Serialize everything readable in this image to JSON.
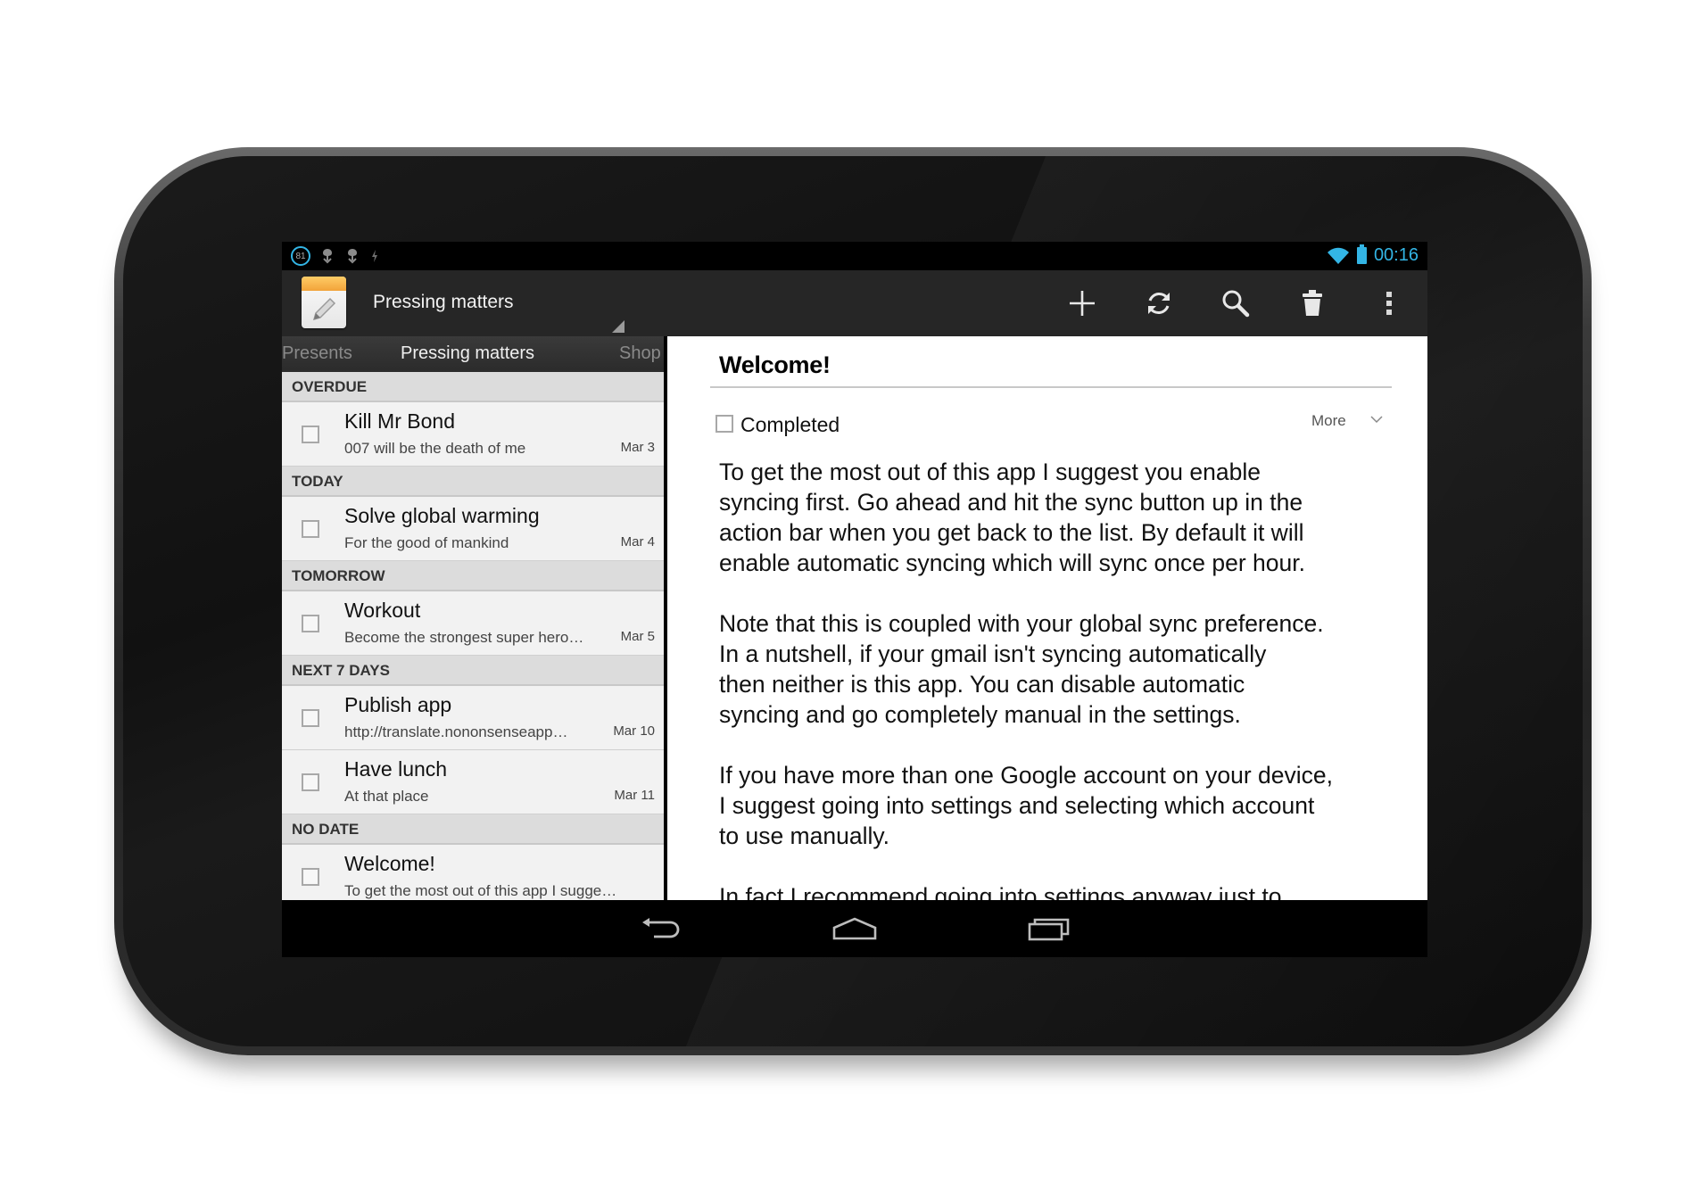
{
  "status_bar": {
    "notification_count": "81",
    "time": "00:16"
  },
  "action_bar": {
    "title": "Pressing matters",
    "actions": [
      {
        "icon": "add-icon"
      },
      {
        "icon": "sync-icon"
      },
      {
        "icon": "search-icon"
      },
      {
        "icon": "delete-icon"
      },
      {
        "icon": "overflow-menu-icon"
      }
    ]
  },
  "tabs": {
    "previous": "Presents",
    "current": "Pressing matters",
    "next": "Shop"
  },
  "list": {
    "sections": [
      {
        "header": "OVERDUE",
        "tasks": [
          {
            "title": "Kill Mr Bond",
            "note": "007 will be the death of me",
            "date": "Mar 3"
          }
        ]
      },
      {
        "header": "TODAY",
        "tasks": [
          {
            "title": "Solve global warming",
            "note": "For the good of mankind",
            "date": "Mar 4"
          }
        ]
      },
      {
        "header": "TOMORROW",
        "tasks": [
          {
            "title": "Workout",
            "note": "Become the strongest super hero…",
            "date": "Mar 5"
          }
        ]
      },
      {
        "header": "NEXT 7 DAYS",
        "tasks": [
          {
            "title": "Publish app",
            "note": "http://translate.nononsenseapp…",
            "date": "Mar 10"
          },
          {
            "title": "Have lunch",
            "note": "At that place",
            "date": "Mar 11"
          }
        ]
      },
      {
        "header": "NO DATE",
        "tasks": [
          {
            "title": "Welcome!",
            "note": "To get the most out of this app I sugge…",
            "date": ""
          }
        ]
      }
    ]
  },
  "detail": {
    "title": "Welcome!",
    "completed_label": "Completed",
    "more_label": "More",
    "body": "To get the most out of this app I suggest you enable\nsyncing first. Go ahead and hit the sync button up in the\naction bar when you get back to the list. By default it will\nenable automatic syncing which will sync once per hour.\n\nNote that this is coupled with your global sync preference.\nIn a nutshell, if your gmail isn't syncing automatically\nthen neither is this app. You can disable automatic\nsyncing and go completely manual in the settings.\n\nIf you have more than one Google account on your device,\nI suggest going into settings and selecting which account\nto use manually.\n\nIn fact I recommend going into settings anyway just to"
  },
  "colors": {
    "accent": "#33b5e5",
    "action_bar": "#262626",
    "list_background": "#e6e6e6",
    "section_header": "#dcdcdc"
  }
}
